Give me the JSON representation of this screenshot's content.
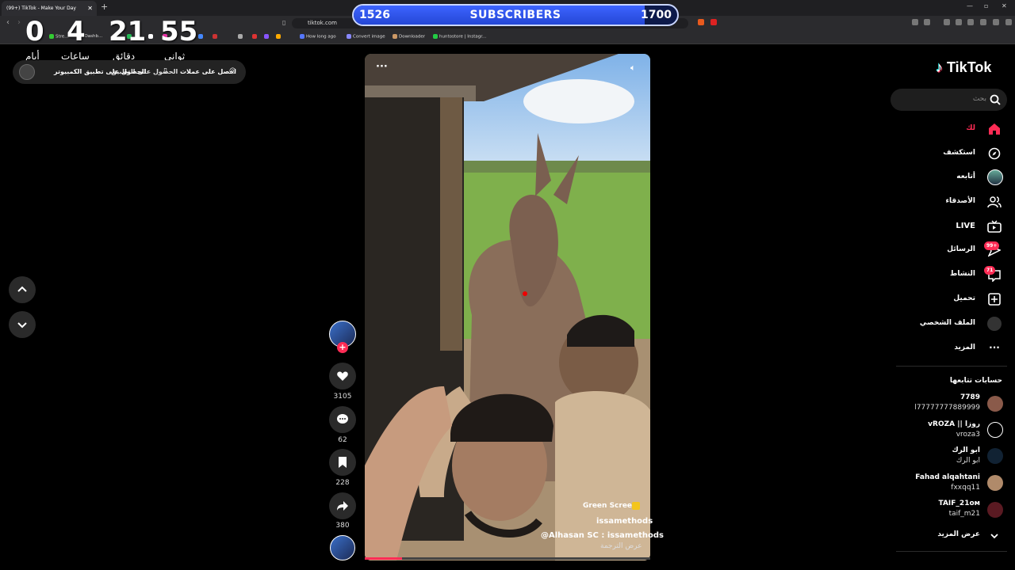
{
  "browser": {
    "tab_title": "(99+) TikTok - Make Your Day",
    "url": "tiktok.com",
    "bookmarks": [
      "Stre...",
      "Ik Dashb...",
      "How long ago",
      "Convert image",
      "Downloader",
      "huntostore | Instagr..."
    ]
  },
  "subscribers": {
    "current": "1526",
    "label": "SUBSCRIBERS",
    "goal": "1700",
    "fill_fraction": 0.9
  },
  "countdown": [
    {
      "value": "0",
      "label": "أيام"
    },
    {
      "value": "4",
      "label": "ساعات"
    },
    {
      "value": "21",
      "label": "دقائق"
    },
    {
      "value": "55",
      "label": "ثواني"
    }
  ],
  "top_pill": {
    "coins": "احصل على عملات",
    "get_app": "الحصول على التطبيق",
    "pc_app": "الحصول على تطبيق الكمبيوتر"
  },
  "video": {
    "green_screen": "Green Screen",
    "author": "issamethods",
    "caption": "@Alhasan  SC : issamethods",
    "translate": "عرض الترجمة",
    "progress_fraction": 0.13
  },
  "actions": {
    "likes": "3105",
    "comments": "62",
    "saves": "228",
    "shares": "380"
  },
  "sidebar": {
    "logo": "TikTok",
    "search_placeholder": "بحث",
    "nav": [
      {
        "label": "لك",
        "icon": "home-icon"
      },
      {
        "label": "استكشف",
        "icon": "compass-icon"
      },
      {
        "label": "أتابعه",
        "icon": "following-icon"
      },
      {
        "label": "الأصدقاء",
        "icon": "friends-icon"
      },
      {
        "label": "LIVE",
        "icon": "live-icon"
      },
      {
        "label": "الرسائل",
        "icon": "messages-icon",
        "badge": "99+"
      },
      {
        "label": "النشاط",
        "icon": "activity-icon",
        "badge": "71"
      },
      {
        "label": "تحميل",
        "icon": "upload-icon"
      },
      {
        "label": "الملف الشخصي",
        "icon": "profile-icon"
      },
      {
        "label": "المزيد",
        "icon": "more-icon"
      }
    ],
    "following_title": "حسابات تتابعها",
    "accounts": [
      {
        "name": "7789",
        "user": "l77777777889999"
      },
      {
        "name": "vROZA || روزا",
        "user": "vroza3"
      },
      {
        "name": "ابو الرك",
        "user": "ابو الرك"
      },
      {
        "name": "Fahad alqahtani",
        "user": "fxxqq11"
      },
      {
        "name": "TAIF_21ᴏᴍ",
        "user": "taif_m21"
      }
    ],
    "see_more": "عرض المزيد"
  },
  "colors": {
    "accent": "#fe2c55",
    "subscriber_bar": "#3d64ff"
  }
}
